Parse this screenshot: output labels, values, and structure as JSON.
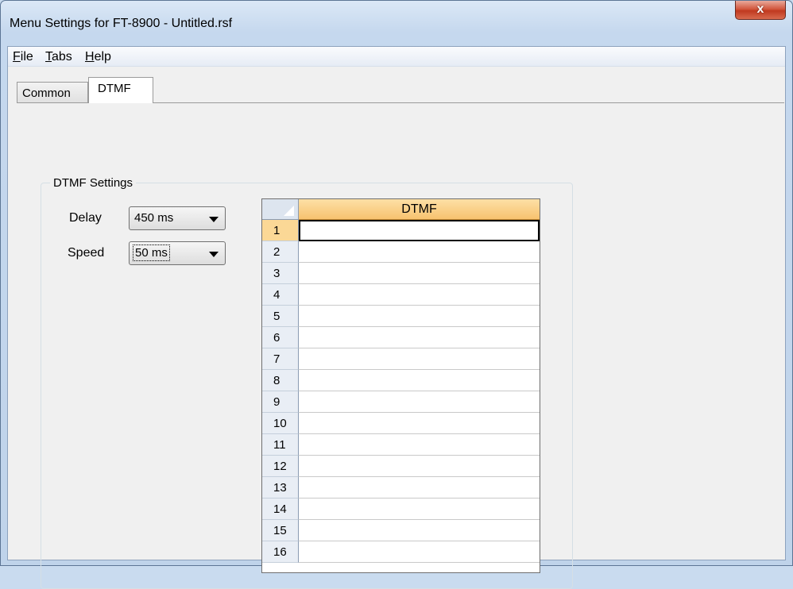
{
  "window": {
    "title": "Menu Settings for FT-8900 - Untitled.rsf",
    "close_glyph": "x"
  },
  "menu": [
    {
      "accel": "F",
      "rest": "ile"
    },
    {
      "accel": "T",
      "rest": "abs"
    },
    {
      "accel": "H",
      "rest": "elp"
    }
  ],
  "tabs": {
    "common": "Common",
    "dtmf": "DTMF",
    "active": "DTMF"
  },
  "dtmf_settings": {
    "group_title": "DTMF Settings",
    "delay_label": "Delay",
    "delay_value": "450 ms",
    "speed_label": "Speed",
    "speed_value": "50 ms"
  },
  "grid": {
    "column_header": "DTMF",
    "active_row": 1,
    "rows": [
      "1",
      "2",
      "3",
      "4",
      "5",
      "6",
      "7",
      "8",
      "9",
      "10",
      "11",
      "12",
      "13",
      "14",
      "15",
      "16"
    ],
    "cells": [
      "",
      "",
      "",
      "",
      "",
      "",
      "",
      "",
      "",
      "",
      "",
      "",
      "",
      "",
      "",
      ""
    ]
  },
  "colors": {
    "header_accent": "#f7c26f",
    "active_row_header": "#fbd896",
    "close_button": "#c0391f"
  }
}
